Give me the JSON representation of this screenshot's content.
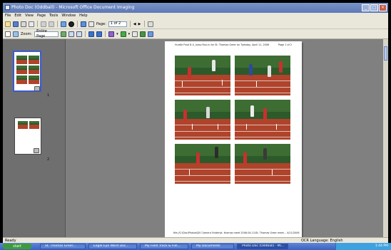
{
  "window": {
    "title": "Photo Doc (Oddball) - Microsoft Office Document Imaging"
  },
  "menu": {
    "items": [
      "File",
      "Edit",
      "View",
      "Page",
      "Tools",
      "Window",
      "Help"
    ]
  },
  "toolbar": {
    "page_label": "Page:",
    "page_value": "1 of 2",
    "zoom_label": "Zoom:",
    "zoom_value": "Entire Page"
  },
  "thumbnails": [
    {
      "number": "1"
    },
    {
      "number": "2"
    }
  ],
  "document": {
    "header": "Hurdle Final 8-4, Jump Run-in for St. Thomas Greer on Tuesday, April 11, 2006",
    "page_indicator": "Page 1 of 2",
    "footer": "file://C:\\Doc\\Photos\\DV Camera Folder\\st. thomas meet 2006-04-11\\St. Thomas Greer meet...   4/11/2006"
  },
  "statusbar": {
    "left": "Ready",
    "ocr": "OCR Language: English"
  },
  "taskbar": {
    "start": "start",
    "tasks": [
      "St. Thomas Greer...",
      "Eagle Eye Word Doc...",
      "My Field Track & Fiel...",
      "My Documents",
      "Photo Doc (Oddball) - Mi..."
    ],
    "clock": "1:44 PM"
  },
  "colors": {
    "track": "#b0432b",
    "grass": "#3e6d33",
    "title_bar": "#5d78b6",
    "selection": "#3a5bd0"
  }
}
